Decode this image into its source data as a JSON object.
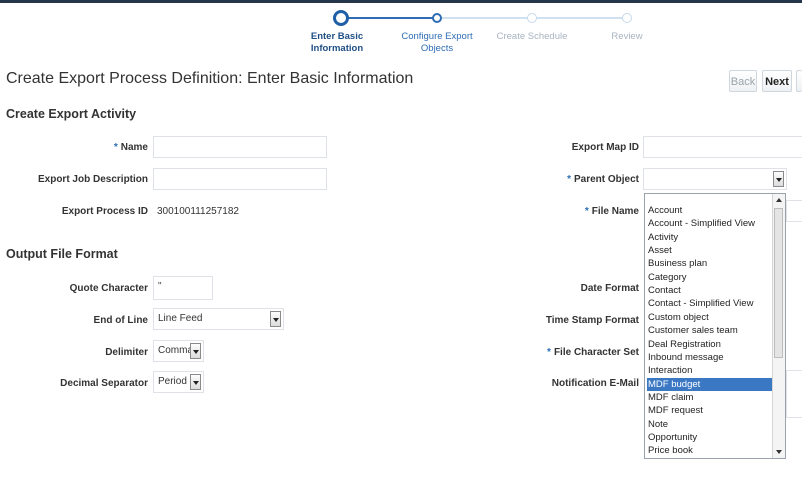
{
  "train": {
    "steps": [
      {
        "label_line1": "Enter Basic",
        "label_line2": "Information"
      },
      {
        "label_line1": "Configure Export",
        "label_line2": "Objects"
      },
      {
        "label_line1": "Create Schedule",
        "label_line2": ""
      },
      {
        "label_line1": "Review",
        "label_line2": ""
      }
    ]
  },
  "header": {
    "title": "Create Export Process Definition: Enter Basic Information",
    "back_label": "Back",
    "next_label": "Next"
  },
  "activity": {
    "section_title": "Create Export Activity",
    "name_label": "Name",
    "name_value": "",
    "job_desc_label": "Export Job Description",
    "job_desc_value": "",
    "process_id_label": "Export Process ID",
    "process_id_value": "300100111257182",
    "map_id_label": "Export Map ID",
    "parent_object_label": "Parent Object",
    "file_name_label": "File Name"
  },
  "output": {
    "section_title": "Output File Format",
    "quote_label": "Quote Character",
    "quote_value": "\"",
    "eol_label": "End of Line",
    "eol_value": "Line Feed",
    "delimiter_label": "Delimiter",
    "delimiter_value": "Comma",
    "decimal_label": "Decimal Separator",
    "decimal_value": "Period",
    "date_format_label": "Date Format",
    "timestamp_label": "Time Stamp Format",
    "charset_label": "File Character Set",
    "notify_label": "Notification E-Mail"
  },
  "dropdown": {
    "options": [
      "Account",
      "Account - Simplified View",
      "Activity",
      "Asset",
      "Business plan",
      "Category",
      "Contact",
      "Contact - Simplified View",
      "Custom object",
      "Customer sales team",
      "Deal Registration",
      "Inbound message",
      "Interaction",
      "MDF budget",
      "MDF claim",
      "MDF request",
      "Note",
      "Opportunity",
      "Price book"
    ],
    "highlighted": "MDF budget"
  },
  "colors": {
    "accent": "#2b6fb6",
    "highlight": "#3b78c4",
    "topbar": "#26364a"
  }
}
